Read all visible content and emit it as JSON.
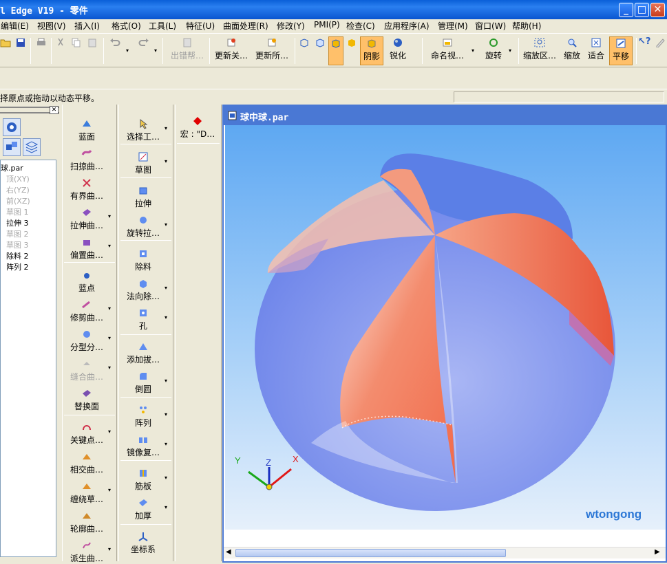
{
  "window": {
    "title": "l Edge V19 - 零件",
    "minimize_icon": "minimize-icon",
    "maximize_icon": "maximize-icon",
    "close_icon": "close-icon"
  },
  "menu": [
    "编辑(E)",
    "视图(V)",
    "插入(I)",
    "格式(O)",
    "工具(L)",
    "特征(U)",
    "曲面处理(R)",
    "修改(Y)",
    "PMI(P)",
    "检查(C)",
    "应用程序(A)",
    "管理(M)",
    "窗口(W)",
    "帮助(H)"
  ],
  "toolbar": {
    "out_of_bounds_help": "出错帮…",
    "update_related": "更新关…",
    "update_all": "更新所…",
    "shade": "阴影",
    "sharpen": "锐化",
    "named_view": "命名视…",
    "rotate": "旋转",
    "zoom_area": "缩放区…",
    "zoom": "缩放",
    "fit": "适合",
    "pan": "平移"
  },
  "status": {
    "prompt": "择原点或拖动以动态平移。"
  },
  "tree": {
    "items": [
      {
        "label": "球.par",
        "disabled": false
      },
      {
        "label": "顶(XY)",
        "disabled": true
      },
      {
        "label": "右(YZ)",
        "disabled": true
      },
      {
        "label": "前(XZ)",
        "disabled": true
      },
      {
        "label": "草图 1",
        "disabled": true
      },
      {
        "label": "拉伸 3",
        "disabled": false
      },
      {
        "label": "草图 2",
        "disabled": true
      },
      {
        "label": "草图 3",
        "disabled": true
      },
      {
        "label": "除料 2",
        "disabled": false
      },
      {
        "label": "阵列 2",
        "disabled": false
      }
    ]
  },
  "surface_tools": [
    "蓝面",
    "扫掠曲…",
    "有界曲…",
    "拉伸曲…",
    "偏置曲…",
    "蓝点",
    "修剪曲…",
    "分型分…",
    "缝合曲…",
    "替换面",
    "关键点…",
    "相交曲…",
    "缠绕草…",
    "轮廓曲…",
    "派生曲…"
  ],
  "feature_tools": [
    "选择工…",
    "草图",
    "拉伸",
    "旋转拉…",
    "除料",
    "法向除…",
    "孔",
    "添加拔…",
    "倒圆",
    "阵列",
    "镜像复…",
    "筋板",
    "加厚",
    "坐标系"
  ],
  "macro": {
    "label": "宏 : \"D…"
  },
  "document": {
    "title": "球中球.par"
  },
  "viewport": {
    "watermark": "wtongong",
    "axis_labels": {
      "x": "X",
      "y": "Y",
      "z": "Z"
    },
    "colors": {
      "blue": "#6f8df0",
      "orange": "#f07a5a",
      "bg_top": "#5ea8f2"
    }
  }
}
